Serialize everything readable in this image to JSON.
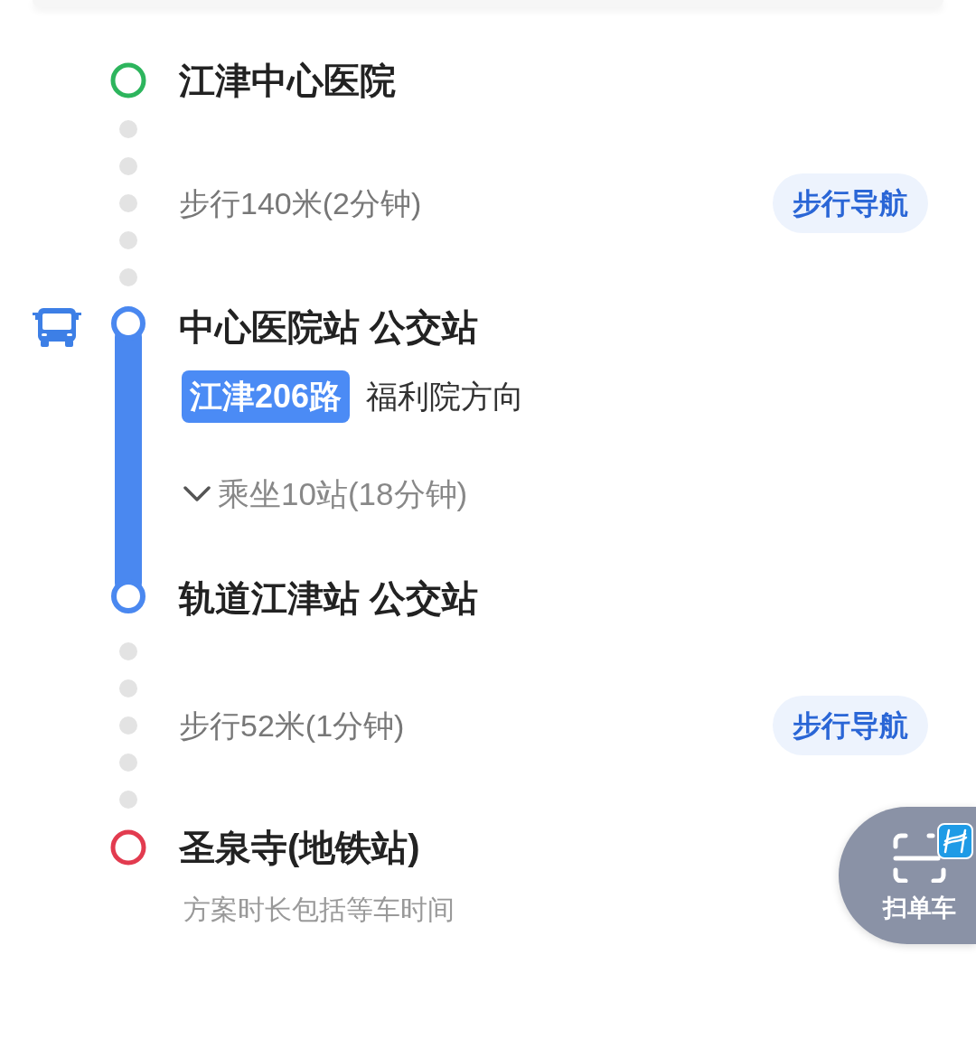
{
  "steps": [
    {
      "kind": "start",
      "title": "江津中心医院",
      "color": "#2db55d"
    },
    {
      "kind": "walk",
      "text": "步行140米(2分钟)",
      "button": "步行导航"
    },
    {
      "kind": "bus",
      "board_stop": "中心医院站 公交站",
      "route": "江津206路",
      "direction": "福利院方向",
      "ride": "乘坐10站(18分钟)",
      "expanded": false,
      "alight_stop": "轨道江津站 公交站"
    },
    {
      "kind": "walk",
      "text": "步行52米(1分钟)",
      "button": "步行导航"
    },
    {
      "kind": "end",
      "title": "圣泉寺(地铁站)",
      "color": "#e23b4f",
      "note": "方案时长包括等车时间"
    }
  ],
  "scan_button": {
    "label": "扫单车"
  }
}
